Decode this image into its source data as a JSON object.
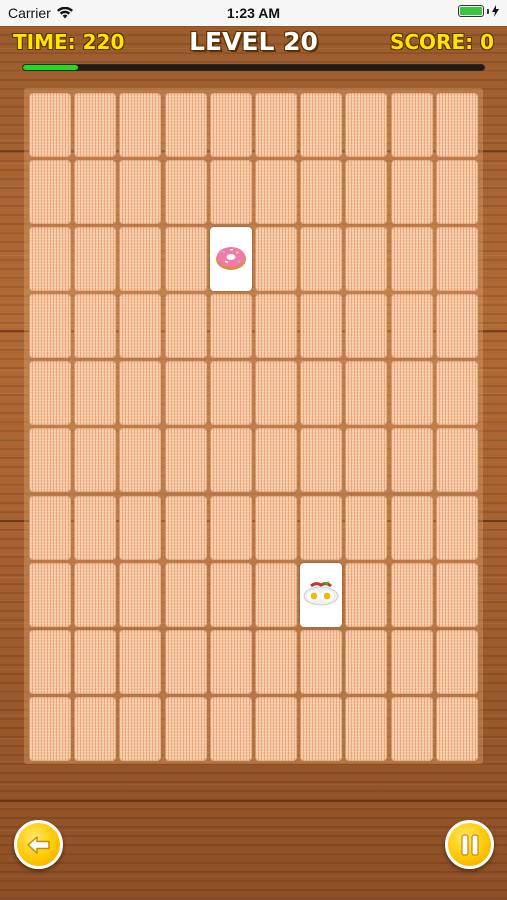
{
  "status_bar": {
    "carrier": "Carrier",
    "time": "1:23 AM",
    "battery_level": 1.0
  },
  "hud": {
    "time_label": "TIME: 220",
    "level_label": "LEVEL 20",
    "score_label": "SCORE: 0",
    "time_progress": 0.12
  },
  "board": {
    "rows": 10,
    "columns": 10,
    "revealed_cards": [
      {
        "row": 3,
        "column": 5,
        "item": "donut-icon"
      },
      {
        "row": 8,
        "column": 7,
        "item": "fried-eggs-bacon-icon"
      }
    ]
  },
  "controls": {
    "back_icon": "arrow-left-icon",
    "pause_icon": "pause-icon"
  },
  "colors": {
    "hud_yellow": "#ffe400",
    "progress_green": "#1edd1e",
    "button_yellow": "#ffc800",
    "card_back": "#f3c8a2"
  }
}
